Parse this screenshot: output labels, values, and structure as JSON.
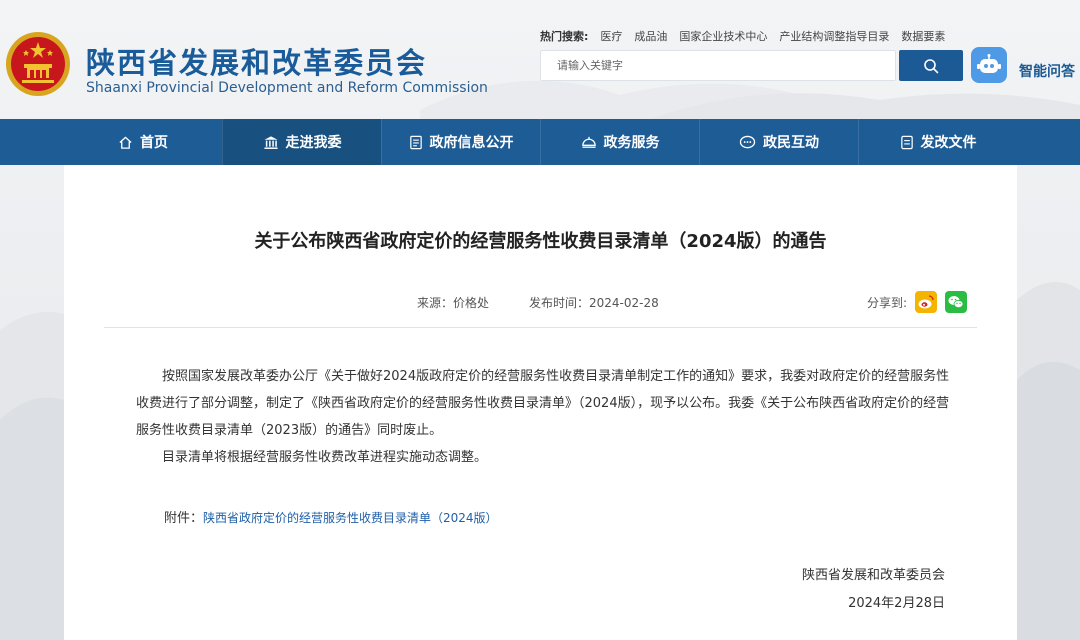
{
  "header": {
    "title_cn": "陕西省发展和改革委员会",
    "title_en": "Shaanxi Provincial Development and Reform Commission",
    "hot_search_label": "热门搜索:",
    "hot_search_items": [
      "医疗",
      "成品油",
      "国家企业技术中心",
      "产业结构调整指导目录",
      "数据要素"
    ],
    "search_placeholder": "请输入关键字",
    "assistant_label": "智能问答"
  },
  "nav": {
    "items": [
      {
        "label": "首页",
        "icon": "home-icon"
      },
      {
        "label": "走进我委",
        "icon": "building-icon"
      },
      {
        "label": "政府信息公开",
        "icon": "document-icon"
      },
      {
        "label": "政务服务",
        "icon": "service-icon"
      },
      {
        "label": "政民互动",
        "icon": "chat-icon"
      },
      {
        "label": "发改文件",
        "icon": "file-icon"
      }
    ],
    "active_index": 1
  },
  "article": {
    "title": "关于公布陕西省政府定价的经营服务性收费目录清单（2024版）的通告",
    "source": "来源：价格处",
    "publish_time": "发布时间：2024-02-28",
    "share_label": "分享到:",
    "paragraph_1": "按照国家发展改革委办公厅《关于做好2024版政府定价的经营服务性收费目录清单制定工作的通知》要求，我委对政府定价的经营服务性收费进行了部分调整，制定了《陕西省政府定价的经营服务性收费目录清单》（2024版），现予以公布。我委《关于公布陕西省政府定价的经营服务性收费目录清单（2023版）的通告》同时废止。",
    "paragraph_2": "目录清单将根据经营服务性收费改革进程实施动态调整。",
    "attachment_label": "附件：",
    "attachment_link": "陕西省政府定价的经营服务性收费目录清单（2024版）",
    "signature_org": "陕西省发展和改革委员会",
    "signature_date": "2024年2月28日"
  },
  "colors": {
    "nav_bg": "#1e5c96",
    "nav_active": "#18507f",
    "title_blue": "#1a5b9a",
    "link_blue": "#1f5fa8",
    "robot_bg": "#4f9ae6",
    "weibo": "#f5b400",
    "wechat": "#2bbd43"
  }
}
